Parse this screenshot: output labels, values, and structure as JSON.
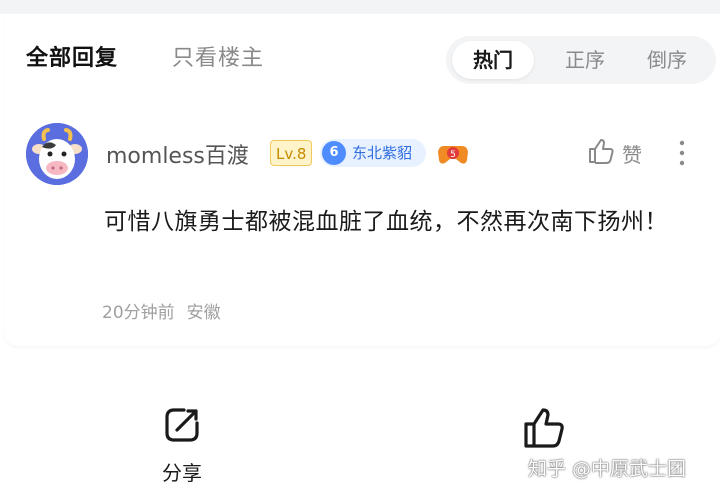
{
  "filters": {
    "all": "全部回复",
    "op_only": "只看楼主"
  },
  "sort": {
    "hot": "热门",
    "asc": "正序",
    "desc": "倒序",
    "active": "hot"
  },
  "comment": {
    "username": "momless百渡",
    "level": "Lv.8",
    "club_level": "6",
    "club_name": "东北紫貂",
    "like_label": "赞",
    "text": "可惜八旗勇士都被混血脏了血统，不然再次南下扬州！",
    "time": "20分钟前",
    "location": "安徽"
  },
  "actions": {
    "share_label": "分享"
  },
  "watermark": "知乎 @中原武士团",
  "icons": {
    "avatar": "cow-avatar",
    "game": "game-controller-icon",
    "like": "thumbs-up-icon",
    "more": "more-vertical-icon",
    "share": "share-icon"
  },
  "colors": {
    "accent_blue": "#4f8cff",
    "level_gold": "#c78a00",
    "muted": "#8a8a8a"
  }
}
